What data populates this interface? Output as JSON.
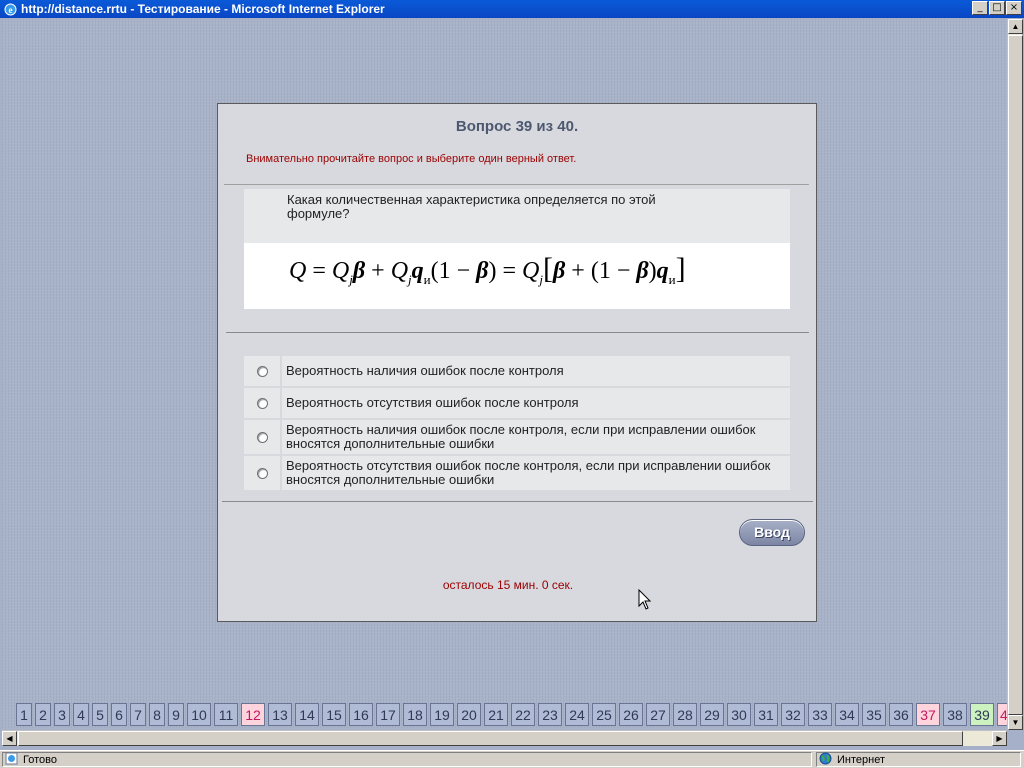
{
  "window": {
    "title": "http://distance.rrtu - Тестирование - Microsoft Internet Explorer",
    "controls": [
      "_",
      "□",
      "×"
    ]
  },
  "question": {
    "heading": "Вопрос 39 из 40.",
    "instruction": "Внимательно прочитайте вопрос и выберите один верный ответ.",
    "text": "Какая количественная характеристика определяется по этой формуле?",
    "formula": {
      "Q": "Q",
      "eq": "=",
      "j": "j",
      "beta": "β",
      "plus": "+",
      "q": "q",
      "i": "и",
      "one_minus": "(1 − ",
      "close_paren": ")",
      "lbracket": "[",
      "rbracket": "]"
    }
  },
  "answers": [
    "Вероятность наличия ошибок после контроля",
    "Вероятность отсутствия ошибок после контроля",
    "Вероятность наличия ошибок после контроля, если при исправлении ошибок вносятся дополнительные ошибки",
    "Вероятность отсутствия ошибок после контроля, если при исправлении ошибок вносятся дополнительные ошибки"
  ],
  "submit_label": "Ввод",
  "timer_text": "осталось 15 мин. 0 сек.",
  "navigator": {
    "items": [
      "1",
      "2",
      "3",
      "4",
      "5",
      "6",
      "7",
      "8",
      "9",
      "10",
      "11",
      "12",
      "13",
      "14",
      "15",
      "16",
      "17",
      "18",
      "19",
      "20",
      "21",
      "22",
      "23",
      "24",
      "25",
      "26",
      "27",
      "28",
      "29",
      "30",
      "31",
      "32",
      "33",
      "34",
      "35",
      "36",
      "37",
      "38",
      "39",
      "4"
    ],
    "highlighted_pink": [
      "12",
      "37"
    ],
    "current_green": "39"
  },
  "status": {
    "left_text": "Готово",
    "zone_text": "Интернет"
  },
  "colors": {
    "accent_red": "#9a0000",
    "heading": "#4d5870",
    "nav_pink": "#ffd4dc",
    "nav_green": "#ccf2c0"
  }
}
